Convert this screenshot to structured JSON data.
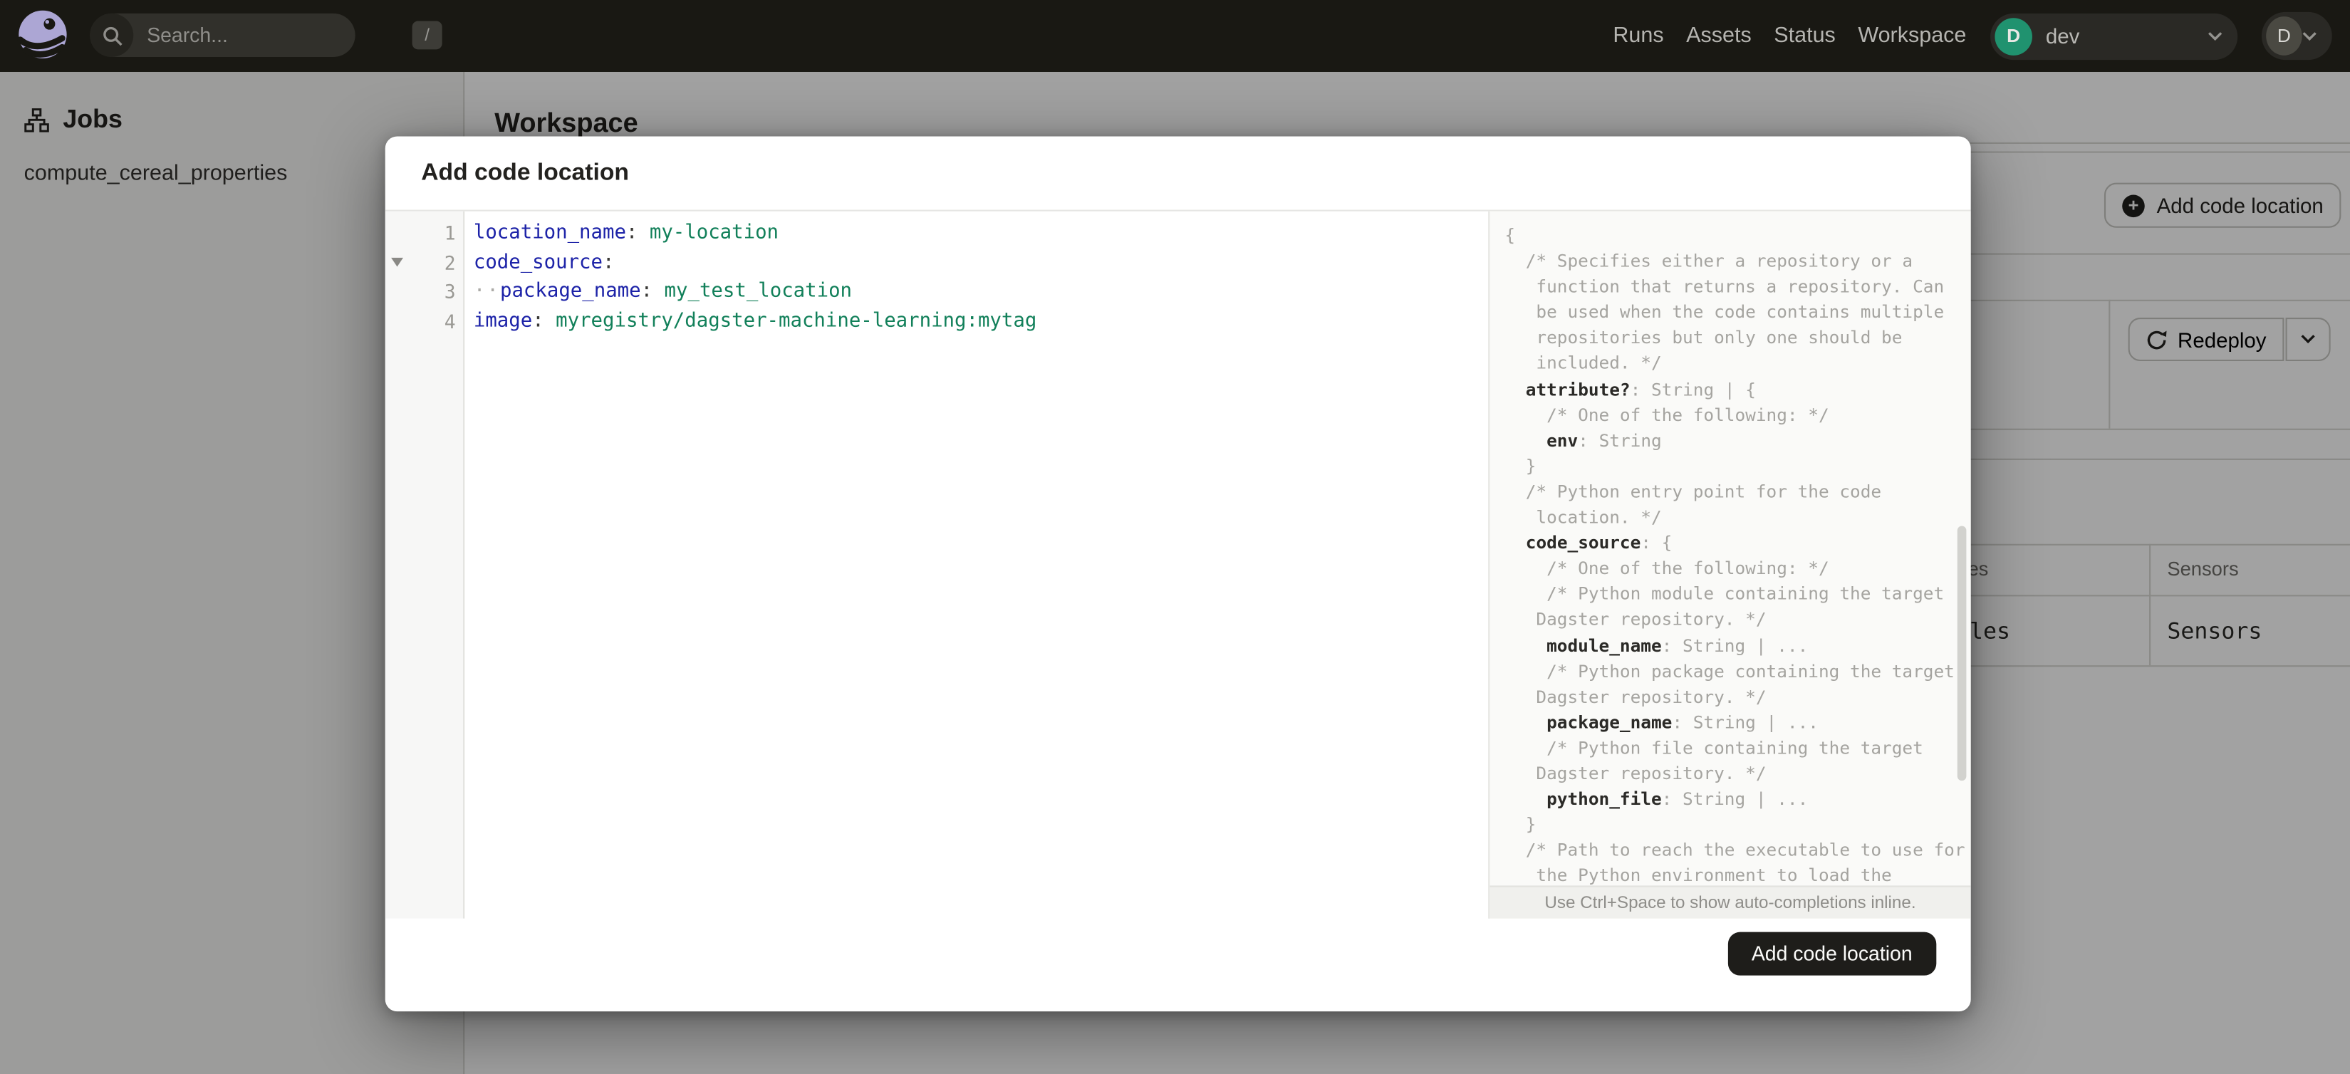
{
  "navbar": {
    "search": {
      "placeholder": "Search...",
      "shortcut_key": "/"
    },
    "links": [
      "Runs",
      "Assets",
      "Status",
      "Workspace"
    ],
    "deployment": {
      "initial": "D",
      "name": "dev"
    },
    "user": {
      "initial": "D"
    }
  },
  "sidebar": {
    "heading": "Jobs",
    "items": [
      "compute_cereal_properties"
    ]
  },
  "background": {
    "page_title": "Workspace",
    "add_button_label": "Add code location",
    "redeploy_button_label": "Redeploy",
    "table": {
      "headers": [
        "Schedules",
        "Sensors"
      ],
      "row": [
        "Schedules",
        "Sensors"
      ]
    }
  },
  "modal": {
    "title": "Add code location",
    "submit_button": "Add code location",
    "hint": "Use Ctrl+Space to show auto-completions inline.",
    "editor": {
      "lines": [
        {
          "num": "1",
          "tokens": [
            {
              "t": "location_name",
              "c": "k"
            },
            {
              "t": ":",
              "c": "p"
            },
            {
              "t": " ",
              "c": "p"
            },
            {
              "t": "my-location",
              "c": "v"
            }
          ]
        },
        {
          "num": "2",
          "tokens": [
            {
              "t": "code_source",
              "c": "k"
            },
            {
              "t": ":",
              "c": "p"
            }
          ]
        },
        {
          "num": "3",
          "tokens": [
            {
              "t": "··",
              "c": "w"
            },
            {
              "t": "package_name",
              "c": "k"
            },
            {
              "t": ":",
              "c": "p"
            },
            {
              "t": " ",
              "c": "p"
            },
            {
              "t": "my_test_location",
              "c": "v"
            }
          ]
        },
        {
          "num": "4",
          "tokens": [
            {
              "t": "image",
              "c": "k"
            },
            {
              "t": ":",
              "c": "p"
            },
            {
              "t": " ",
              "c": "p"
            },
            {
              "t": "myregistry/dagster-machine-learning:mytag",
              "c": "v"
            }
          ]
        }
      ]
    },
    "schema": {
      "lines": [
        [
          {
            "t": "{",
            "c": "p"
          }
        ],
        [
          {
            "t": "  /* Specifies either a repository or a",
            "c": "p"
          }
        ],
        [
          {
            "t": "   function that returns a repository. Can",
            "c": "p"
          }
        ],
        [
          {
            "t": "   be used when the code contains multiple",
            "c": "p"
          }
        ],
        [
          {
            "t": "   repositories but only one should be",
            "c": "p"
          }
        ],
        [
          {
            "t": "   included. */",
            "c": "p"
          }
        ],
        [
          {
            "t": "  ",
            "c": "p"
          },
          {
            "t": "attribute?",
            "c": "k"
          },
          {
            "t": ": String | {",
            "c": "p"
          }
        ],
        [
          {
            "t": "    /* One of the following: */",
            "c": "p"
          }
        ],
        [
          {
            "t": "    ",
            "c": "p"
          },
          {
            "t": "env",
            "c": "k"
          },
          {
            "t": ": String",
            "c": "p"
          }
        ],
        [
          {
            "t": "  }",
            "c": "p"
          }
        ],
        [
          {
            "t": "  /* Python entry point for the code",
            "c": "p"
          }
        ],
        [
          {
            "t": "   location. */",
            "c": "p"
          }
        ],
        [
          {
            "t": "  ",
            "c": "p"
          },
          {
            "t": "code_source",
            "c": "k"
          },
          {
            "t": ": {",
            "c": "p"
          }
        ],
        [
          {
            "t": "    /* One of the following: */",
            "c": "p"
          }
        ],
        [
          {
            "t": "    /* Python module containing the target",
            "c": "p"
          }
        ],
        [
          {
            "t": "   Dagster repository. */",
            "c": "p"
          }
        ],
        [
          {
            "t": "    ",
            "c": "p"
          },
          {
            "t": "module_name",
            "c": "k"
          },
          {
            "t": ": String | ...",
            "c": "p"
          }
        ],
        [
          {
            "t": "    /* Python package containing the target",
            "c": "p"
          }
        ],
        [
          {
            "t": "   Dagster repository. */",
            "c": "p"
          }
        ],
        [
          {
            "t": "    ",
            "c": "p"
          },
          {
            "t": "package_name",
            "c": "k"
          },
          {
            "t": ": String | ...",
            "c": "p"
          }
        ],
        [
          {
            "t": "    /* Python file containing the target",
            "c": "p"
          }
        ],
        [
          {
            "t": "   Dagster repository. */",
            "c": "p"
          }
        ],
        [
          {
            "t": "    ",
            "c": "p"
          },
          {
            "t": "python_file",
            "c": "k"
          },
          {
            "t": ": String | ...",
            "c": "p"
          }
        ],
        [
          {
            "t": "  }",
            "c": "p"
          }
        ],
        [
          {
            "t": "  /* Path to reach the executable to use for",
            "c": "p"
          }
        ],
        [
          {
            "t": "   the Python environment to load the",
            "c": "p"
          }
        ]
      ]
    }
  },
  "colors": {
    "navbar_bg": "#191813",
    "logo_lavender": "#ACA6D4",
    "dev_badge_green": "#20926F",
    "editor_key": "#1D23A8",
    "editor_value": "#12805A",
    "modal_submit_bg": "#1E1D1A"
  }
}
